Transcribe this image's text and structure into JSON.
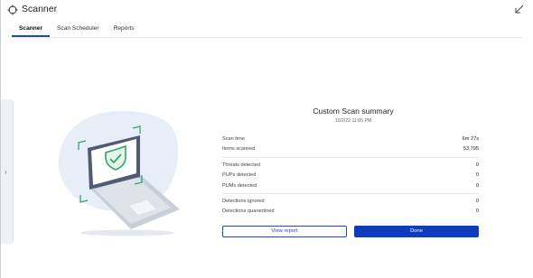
{
  "window": {
    "title": "Scanner"
  },
  "tabs": [
    {
      "label": "Scanner",
      "active": true
    },
    {
      "label": "Scan Scheduler",
      "active": false
    },
    {
      "label": "Reports",
      "active": false
    }
  ],
  "summary": {
    "title": "Custom Scan summary",
    "date": "10/2/22 11:05 PM",
    "rows": {
      "scan_time": {
        "label": "Scan time",
        "value": "6m 27s"
      },
      "items_scanned": {
        "label": "Items scanned",
        "value": "53,795"
      },
      "threats": {
        "label": "Threats detected",
        "value": "0"
      },
      "pups": {
        "label": "PUPs detected",
        "value": "0"
      },
      "pums": {
        "label": "PUMs detected",
        "value": "0"
      },
      "ignored": {
        "label": "Detections ignored",
        "value": "0"
      },
      "quarantined": {
        "label": "Detections quarantined",
        "value": "0"
      }
    }
  },
  "buttons": {
    "view_report": "View report",
    "done": "Done"
  },
  "colors": {
    "accent": "#1f4db8",
    "primary_button": "#0f3bbd",
    "shield": "#2fa866"
  },
  "icons": {
    "app": "crosshair-icon",
    "collapse": "collapse-arrow-icon",
    "side": "chevron-right-icon"
  }
}
